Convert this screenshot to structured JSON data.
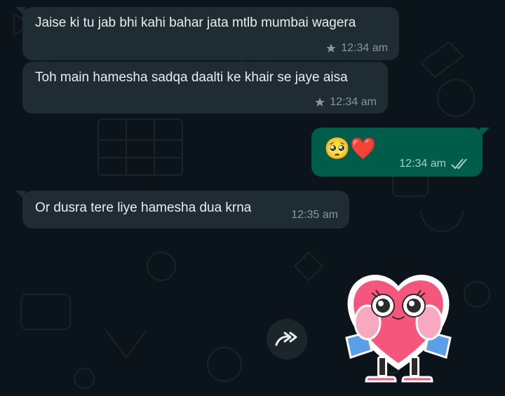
{
  "messages": [
    {
      "direction": "in",
      "text": "Jaise ki tu jab bhi kahi bahar jata mtlb mumbai wagera",
      "time": "12:34 am",
      "starred": true
    },
    {
      "direction": "in",
      "text": "Toh main hamesha sadqa daalti ke khair se jaye aisa",
      "time": "12:34 am",
      "starred": true
    },
    {
      "direction": "out",
      "text": "🥺❤️",
      "time": "12:34 am",
      "status": "read"
    },
    {
      "direction": "in",
      "text": "Or dusra tere liye hamesha dua krna",
      "time": "12:35 am",
      "starred": false
    }
  ],
  "sticker": {
    "icon": "heart-character-sticker",
    "color": "#f5567c"
  },
  "forward": {
    "icon": "forward-icon"
  },
  "colors": {
    "background": "#0b141a",
    "incoming": "#1f2c33",
    "outgoing": "#005c4b",
    "text": "#e9edef",
    "meta": "#8696a0",
    "read_ticks": "#a6cfc4"
  }
}
